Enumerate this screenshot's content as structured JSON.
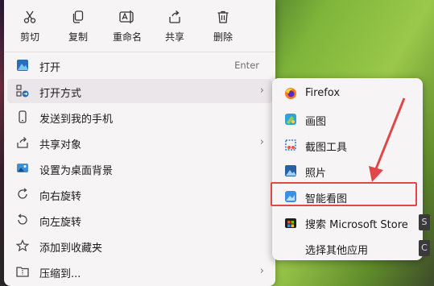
{
  "toolbar": {
    "cut_label": "剪切",
    "copy_label": "复制",
    "rename_label": "重命名",
    "share_label": "共享",
    "delete_label": "删除"
  },
  "menu": {
    "items": [
      {
        "label": "打开",
        "shortcut": "Enter",
        "icon": "image-icon"
      },
      {
        "label": "打开方式",
        "has_submenu": true,
        "highlighted": true,
        "icon": "open-with-icon"
      },
      {
        "label": "发送到我的手机",
        "icon": "phone-icon"
      },
      {
        "label": "共享对象",
        "has_submenu": true,
        "icon": "share-icon"
      },
      {
        "label": "设置为桌面背景",
        "icon": "wallpaper-icon"
      },
      {
        "label": "向右旋转",
        "icon": "rotate-right-icon"
      },
      {
        "label": "向左旋转",
        "icon": "rotate-left-icon"
      },
      {
        "label": "添加到收藏夹",
        "icon": "star-icon"
      },
      {
        "label": "压缩到...",
        "has_submenu": true,
        "icon": "zip-icon"
      }
    ]
  },
  "submenu": {
    "items": [
      {
        "label": "Firefox",
        "icon": "firefox-icon"
      },
      {
        "label": "画图",
        "icon": "paint-icon"
      },
      {
        "label": "截图工具",
        "icon": "snipping-tool-icon"
      },
      {
        "label": "照片",
        "icon": "photos-icon"
      },
      {
        "label": "智能看图",
        "icon": "smart-viewer-icon",
        "annotated": true
      },
      {
        "label": "搜索 Microsoft Store",
        "icon": "store-icon"
      },
      {
        "label": "选择其他应用",
        "icon": ""
      }
    ]
  },
  "edge_keys": [
    "S",
    "C"
  ],
  "colors": {
    "annotation": "#e04848",
    "menu_bg": "#f7f4f6",
    "highlight": "#ebe6ea"
  }
}
